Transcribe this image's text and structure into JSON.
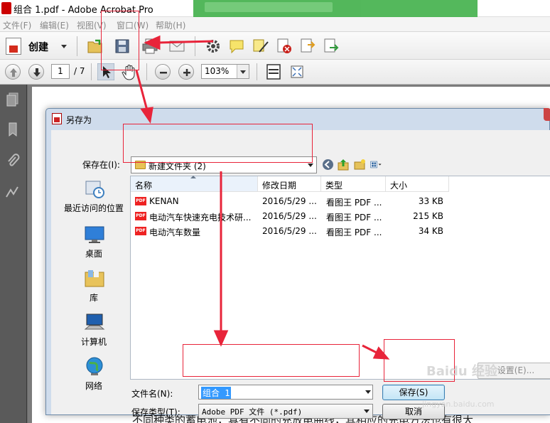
{
  "window": {
    "title": "组合 1.pdf - Adobe Acrobat Pro"
  },
  "menu": [
    "文件(F)",
    "编辑(E)",
    "视图(V)",
    "窗口(W)",
    "帮助(H)"
  ],
  "toolbar": {
    "create_label": "创建",
    "page_current": "1",
    "page_total": "/ 7",
    "zoom": "103%"
  },
  "dialog": {
    "title": "另存为",
    "save_in_label": "保存在(I):",
    "save_in_value": "新建文件夹 (2)",
    "places": [
      "最近访问的位置",
      "桌面",
      "库",
      "计算机",
      "网络"
    ],
    "columns": [
      "名称",
      "修改日期",
      "类型",
      "大小"
    ],
    "files": [
      {
        "name": "KENAN",
        "date": "2016/5/29 ...",
        "type": "看图王 PDF ...",
        "size": "33 KB"
      },
      {
        "name": "电动汽车快速充电技术研...",
        "date": "2016/5/29 ...",
        "type": "看图王 PDF ...",
        "size": "215 KB"
      },
      {
        "name": "电动汽车数量",
        "date": "2016/5/29 ...",
        "type": "看图王 PDF ...",
        "size": "34 KB"
      }
    ],
    "settings_button": "设置(E)...",
    "filename_label": "文件名(N):",
    "filename_value": "组合 1",
    "filetype_label": "保存类型(T):",
    "filetype_value": "Adobe PDF 文件 (*.pdf)",
    "save_button": "保存(S)",
    "cancel_button": "取消"
  },
  "document": {
    "visible_text": "不同种类的蓄电池，具有不同的充放电曲线，其相应的充电方法也有很大"
  },
  "watermark": {
    "brand": "Baidu 经验",
    "url": "jingyan.baidu.com"
  },
  "colors": {
    "annotation_red": "#e8243a",
    "selection_blue": "#3399ff"
  }
}
